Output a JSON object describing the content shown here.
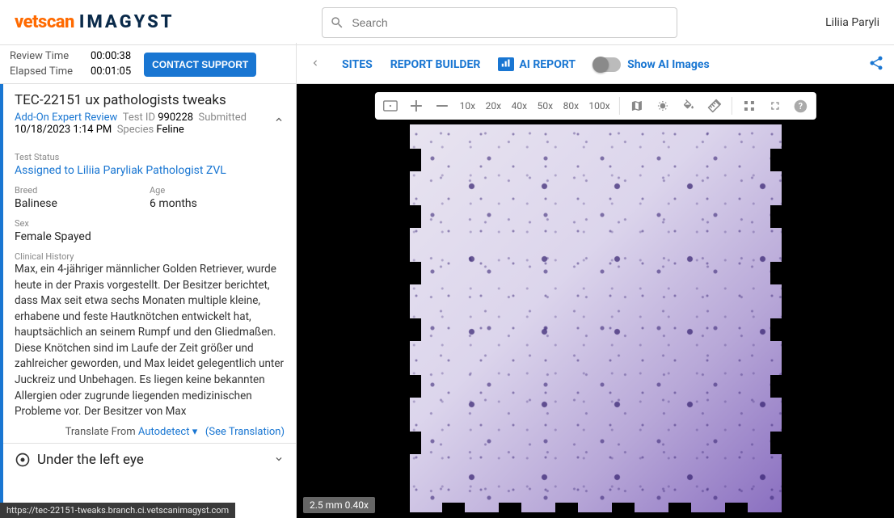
{
  "header": {
    "logo_part1": "vetscan",
    "logo_part2": "IMAGYST",
    "search_placeholder": "Search",
    "username": "Liliia Paryli"
  },
  "left_head": {
    "review_label": "Review Time",
    "review_value": "00:00:38",
    "elapsed_label": "Elapsed Time",
    "elapsed_value": "00:01:05",
    "support_button": "CONTACT SUPPORT"
  },
  "breadcrumb": {
    "sites": "SITES",
    "report_builder": "REPORT BUILDER",
    "ai_report_badge": "ılı.",
    "ai_report": "AI REPORT",
    "show_ai_images": "Show AI Images"
  },
  "case": {
    "title": "TEC-22151 ux pathologists tweaks",
    "review_type": "Add-On Expert Review",
    "test_id_label": "Test ID",
    "test_id": "990228",
    "submitted_label": "Submitted",
    "submitted_datetime": "10/18/2023 1:14 PM",
    "species_label": "Species",
    "species": "Feline"
  },
  "details": {
    "test_status_label": "Test Status",
    "assigned": "Assigned to Liliia Paryliak Pathologist ZVL",
    "breed_label": "Breed",
    "breed": "Balinese",
    "age_label": "Age",
    "age": "6 months",
    "sex_label": "Sex",
    "sex": "Female Spayed",
    "history_label": "Clinical History",
    "history_text": "Max, ein 4-jähriger männlicher Golden Retriever, wurde heute in der Praxis vorgestellt. Der Besitzer berichtet, dass Max seit etwa sechs Monaten multiple kleine, erhabene und feste Hautknötchen entwickelt hat, hauptsächlich an seinem Rumpf und den Gliedmaßen. Diese Knötchen sind im Laufe der Zeit größer und zahlreicher geworden, und Max leidet gelegentlich unter Juckreiz und Unbehagen. Es liegen keine bekannten Allergien oder zugrunde liegenden medizinischen Probleme vor. Der Besitzer von Max"
  },
  "translate": {
    "translate_from": "Translate From",
    "autodetect": "Autodetect",
    "see_translation": "(See Translation)"
  },
  "under_section": {
    "title": "Under the left eye"
  },
  "viewer_toolbar": {
    "zoom_levels": [
      "10x",
      "20x",
      "40x",
      "50x",
      "80x",
      "100x"
    ]
  },
  "scale_badge": "2.5 mm 0.40x",
  "browser_url": "https://tec-22151-tweaks.branch.ci.vetscanimagyst.com"
}
